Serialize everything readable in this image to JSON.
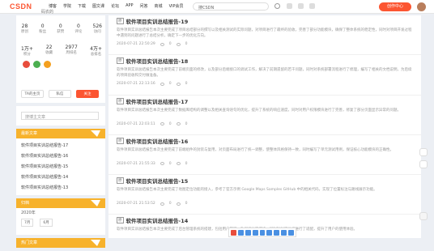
{
  "header": {
    "logo": "CSDN",
    "nav": [
      "博客",
      "学院",
      "下载",
      "图文课",
      "论坛",
      "APP",
      "问答",
      "商城",
      "VIP会员"
    ],
    "search_placeholder": "搜CSDN",
    "publish_label": "写博客",
    "publish_label2": "创作中心"
  },
  "profile": {
    "username": "码农的",
    "stats_top": [
      {
        "value": "28",
        "label": "原创"
      },
      {
        "value": "0",
        "label": "粉丝"
      },
      {
        "value": "0",
        "label": "获赞"
      },
      {
        "value": "0",
        "label": "评论"
      },
      {
        "value": "526",
        "label": "访问"
      }
    ],
    "stats_bottom": [
      {
        "value": "1万+",
        "label": "积分"
      },
      {
        "value": "22",
        "label": "收藏"
      },
      {
        "value": "2977",
        "label": "周排名"
      },
      {
        "value": "4万+",
        "label": "总排名"
      }
    ],
    "buttons": [
      "TA的主页",
      "私信",
      "关注"
    ]
  },
  "sidebar_search": {
    "placeholder": "搜博主文章"
  },
  "recent": {
    "title": "最新文章",
    "items": [
      "软件项目实训总结报告-17",
      "软件项目实训总结报告-16",
      "软件项目实训总结报告-15",
      "软件项目实训总结报告-14",
      "软件项目实训总结报告-13"
    ]
  },
  "category": {
    "title": "归档",
    "row1": [
      "2020年",
      "10篇"
    ],
    "tags": [
      "7月",
      "6月"
    ]
  },
  "hot": {
    "title": "热门文章"
  },
  "articles": [
    {
      "title": "软件项目实训总结报告-19",
      "desc": "软件项目实训总结报告本次主要完成了项目总结部分的撰写以及相关测试的实际问题，对项目进行了最终的验收，完善了部分功能模块，确保了整体系统的稳定性，同时对项目开发过程中遇到的问题进行了总结分析，确定下一步的优化方向。",
      "date": "2020-07-21 22:50:29",
      "views": "0",
      "comments": "0"
    },
    {
      "title": "软件项目实训总结报告-18",
      "desc": "软件项目实训总结报告本次主要完成了前端页面的修改，以及部分后端接口的调试工作，解决了前期遗留的若干问题，同时对系统部署流程进行了梳理，编写了相关的文档说明，为后续的项目验收和交付做准备。",
      "date": "2020-07-21 22:13:16",
      "views": "0",
      "comments": "0"
    },
    {
      "title": "软件项目实训总结报告-17",
      "desc": "软件项目实训总结报告本次主要完成了数据库结构的调整以及相关查询语句的优化，提升了系统的响应速度，同时对用户权限模块进行了完善，修复了部分页面显示异常的问题。",
      "date": "2020-07-21 22:03:11",
      "views": "0",
      "comments": "0"
    },
    {
      "title": "软件项目实训总结报告-16",
      "desc": "软件项目实训总结报告本次主要完成了前端组件的封装与复用，对页面布局进行了统一调整，使整体风格保持一致，同时编写了单元测试用例，保证核心功能模块的正确性。",
      "date": "2020-07-21 21:55:33",
      "views": "0",
      "comments": "0"
    },
    {
      "title": "软件项目实训总结报告-15",
      "desc": "软件项目实训总结报告本次主要完成了地图定位功能的接入，参考了官方示例 Google Maps Samples GitHub 中的相关代码，实现了位置标注与路线展示功能。",
      "date": "2020-07-21 21:53:52",
      "views": "0",
      "comments": "0"
    },
    {
      "title": "软件项目实训总结报告-14",
      "desc": "软件项目实训总结报告本次主要完成了后台管理系统的搭建，包括用户管理、数据统计等模块，同时针对移动端进行了适配，提升了用户的使用体验。",
      "date": "2020-07-21 21:50:10",
      "views": "0",
      "comments": "0"
    }
  ],
  "colors": {
    "accent": "#fc5531",
    "section": "#f7b22c"
  }
}
